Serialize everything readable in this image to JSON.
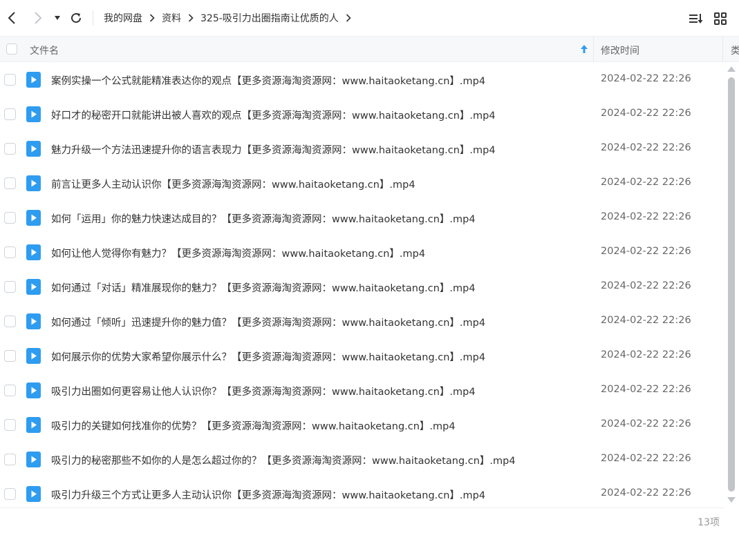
{
  "toolbar": {
    "back_icon": "chevron-left-icon",
    "forward_icon": "chevron-right-icon",
    "dropdown_icon": "caret-down-icon",
    "refresh_icon": "refresh-icon",
    "sort_icon": "sort-list-icon",
    "grid_icon": "grid-view-icon"
  },
  "breadcrumb": [
    "我的网盘",
    "资料",
    "325-吸引力出圈指南让优质的人"
  ],
  "columns": {
    "name": "文件名",
    "time": "修改时间",
    "type": "类"
  },
  "accent_color": "#2e9cf0",
  "files": [
    {
      "name": "案例实操一个公式就能精准表达你的观点【更多资源海淘资源网：www.haitaoketang.cn】.mp4",
      "time": "2024-02-22 22:26"
    },
    {
      "name": "好口才的秘密开口就能讲出被人喜欢的观点【更多资源海淘资源网：www.haitaoketang.cn】.mp4",
      "time": "2024-02-22 22:26"
    },
    {
      "name": "魅力升级一个方法迅速提升你的语言表现力【更多资源海淘资源网：www.haitaoketang.cn】.mp4",
      "time": "2024-02-22 22:26"
    },
    {
      "name": "前言让更多人主动认识你【更多资源海淘资源网：www.haitaoketang.cn】.mp4",
      "time": "2024-02-22 22:26"
    },
    {
      "name": "如何「运用」你的魅力快速达成目的？【更多资源海淘资源网：www.haitaoketang.cn】.mp4",
      "time": "2024-02-22 22:26"
    },
    {
      "name": "如何让他人觉得你有魅力？【更多资源海淘资源网：www.haitaoketang.cn】.mp4",
      "time": "2024-02-22 22:26"
    },
    {
      "name": "如何通过「对话」精准展现你的魅力？【更多资源海淘资源网：www.haitaoketang.cn】.mp4",
      "time": "2024-02-22 22:26"
    },
    {
      "name": "如何通过「倾听」迅速提升你的魅力值？【更多资源海淘资源网：www.haitaoketang.cn】.mp4",
      "time": "2024-02-22 22:26"
    },
    {
      "name": "如何展示你的优势大家希望你展示什么？【更多资源海淘资源网：www.haitaoketang.cn】.mp4",
      "time": "2024-02-22 22:26"
    },
    {
      "name": "吸引力出圈如何更容易让他人认识你？【更多资源海淘资源网：www.haitaoketang.cn】.mp4",
      "time": "2024-02-22 22:26"
    },
    {
      "name": "吸引力的关键如何找准你的优势？【更多资源海淘资源网：www.haitaoketang.cn】.mp4",
      "time": "2024-02-22 22:26"
    },
    {
      "name": "吸引力的秘密那些不如你的人是怎么超过你的？【更多资源海淘资源网：www.haitaoketang.cn】.mp4",
      "time": "2024-02-22 22:26"
    },
    {
      "name": "吸引力升级三个方式让更多人主动认识你【更多资源海淘资源网：www.haitaoketang.cn】.mp4",
      "time": "2024-02-22 22:26"
    }
  ],
  "item_count": "13项"
}
